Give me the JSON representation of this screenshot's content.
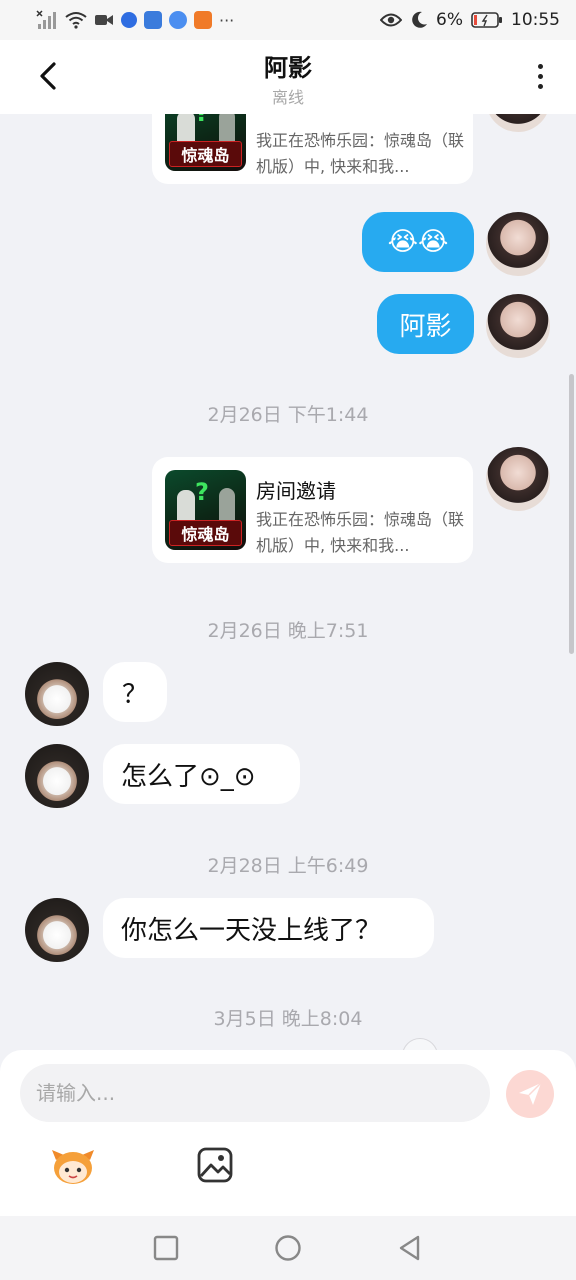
{
  "status_bar": {
    "battery": "6%",
    "time": "10:55"
  },
  "header": {
    "title": "阿影",
    "subtitle": "离线"
  },
  "messages": {
    "card_top_desc": "我正在恐怖乐园：惊魂岛（联机版）中, 快来和我...",
    "card_top_logo": "惊魂岛",
    "emoji_msg": "😭😭",
    "me_name_msg": "阿影",
    "time1": "2月26日 下午1:44",
    "card_title": "房间邀请",
    "card_desc": "我正在恐怖乐园：惊魂岛（联机版）中, 快来和我...",
    "card_logo": "惊魂岛",
    "time2": "2月26日 晚上7:51",
    "msg_q": "？",
    "msg_what": "怎么了⊙_⊙",
    "time3": "2月28日 上午6:49",
    "msg_why": "你怎么一天没上线了？",
    "time4": "3月5日 晚上8:04"
  },
  "input": {
    "placeholder": "请输入..."
  },
  "colors": {
    "bubble_me": "#27aaf0",
    "send_disabled": "#fcd8d3",
    "background": "#f1f2f6"
  }
}
